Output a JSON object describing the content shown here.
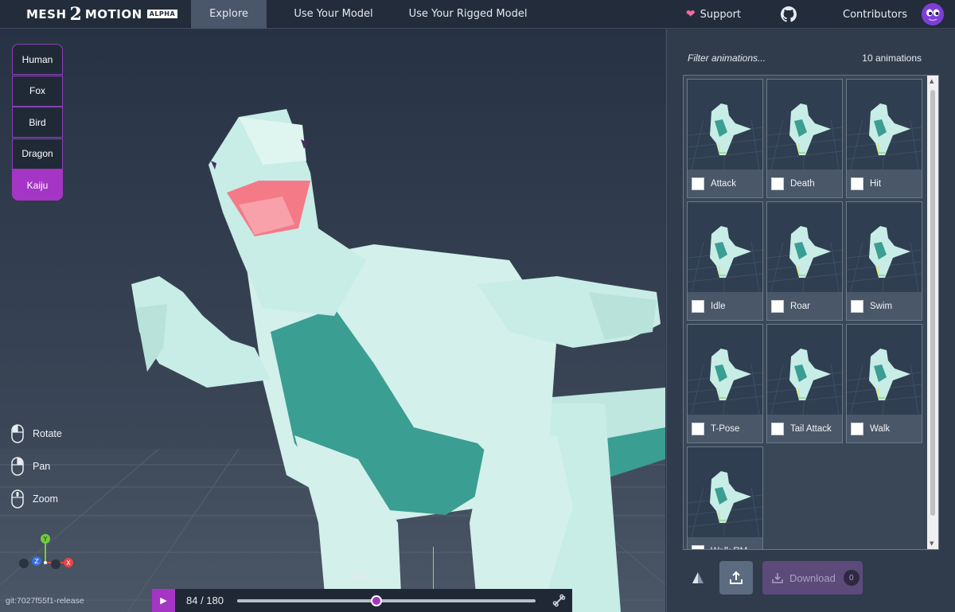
{
  "brand": {
    "word1": "MESH",
    "num": "2",
    "word2": "MOTION",
    "badge": "ALPHA"
  },
  "nav": {
    "tabs": [
      "Explore",
      "Use Your Model",
      "Use Your Rigged Model"
    ],
    "active": "Explore"
  },
  "top_right": {
    "support": "Support",
    "contributors": "Contributors"
  },
  "models": {
    "items": [
      "Human",
      "Fox",
      "Bird",
      "Dragon",
      "Kaiju"
    ],
    "selected": "Kaiju"
  },
  "controls_help": {
    "rotate": "Rotate",
    "pan": "Pan",
    "zoom": "Zoom"
  },
  "axes": {
    "y": "Y",
    "z": "Z",
    "x": "X"
  },
  "version": "git:7027f55f1-release",
  "current_animation": "Roar",
  "playback": {
    "frame": "84 / 180",
    "progress": 0.467
  },
  "panel": {
    "filter_placeholder": "Filter animations...",
    "count": "10 animations",
    "animations": [
      "Attack",
      "Death",
      "Hit",
      "Idle",
      "Roar",
      "Swim",
      "T-Pose",
      "Tail Attack",
      "Walk",
      "Walk RM"
    ],
    "download_label": "Download",
    "download_count": "0"
  },
  "colors": {
    "accent": "#a535c4",
    "topbar": "#222c3a",
    "panel": "#303c4c",
    "kaiju_light": "#c8ece6",
    "kaiju_teal": "#3a9e92"
  }
}
